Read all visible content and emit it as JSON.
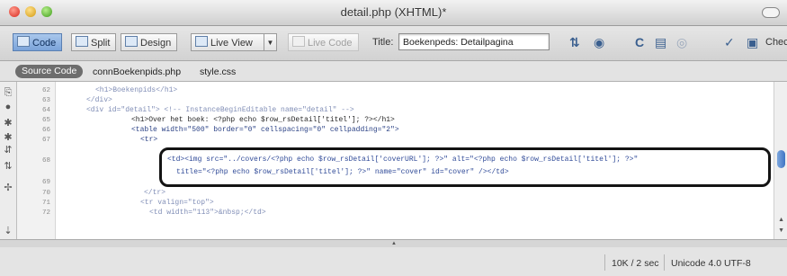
{
  "window": {
    "title": "detail.php (XHTML)*"
  },
  "toolbar": {
    "code_label": "Code",
    "split_label": "Split",
    "design_label": "Design",
    "live_view_label": "Live View",
    "live_code_label": "Live Code",
    "title_label": "Title:",
    "title_value": "Boekenpeds: Detailpagina",
    "check_label": "Chec"
  },
  "related_files": {
    "source_code_label": "Source Code",
    "files": [
      "connBoekenpids.php",
      "style.css"
    ]
  },
  "editor": {
    "line_numbers": [
      "62",
      "63",
      "64",
      "65",
      "66",
      "67",
      "68",
      "69",
      "70",
      "71",
      "72"
    ],
    "lines": [
      "<h1>Boekenpids</h1>",
      "</div>",
      "<div id=\"detail\"> <!-- InstanceBeginEditable name=\"detail\" -->",
      "<h1>Over het boek: <?php echo $row_rsDetail['titel']; ?></h1>",
      "<table width=\"500\" border=\"0\" cellspacing=\"0\" cellpadding=\"2\">",
      "<tr>",
      "<td><img src=\"../covers/<?php echo $row_rsDetail['coverURL']; ?>\" alt=\"<?php echo $row_rsDetail['titel']; ?>\"",
      "title=\"<?php echo $row_rsDetail['titel']; ?>\" name=\"cover\" id=\"cover\" /></td>",
      "</tr>",
      "<tr valign=\"top\">",
      "<td width=\"113\">&nbsp;</td>"
    ]
  },
  "status": {
    "size": "10K / 2 sec",
    "encoding": "Unicode 4.0 UTF-8"
  }
}
